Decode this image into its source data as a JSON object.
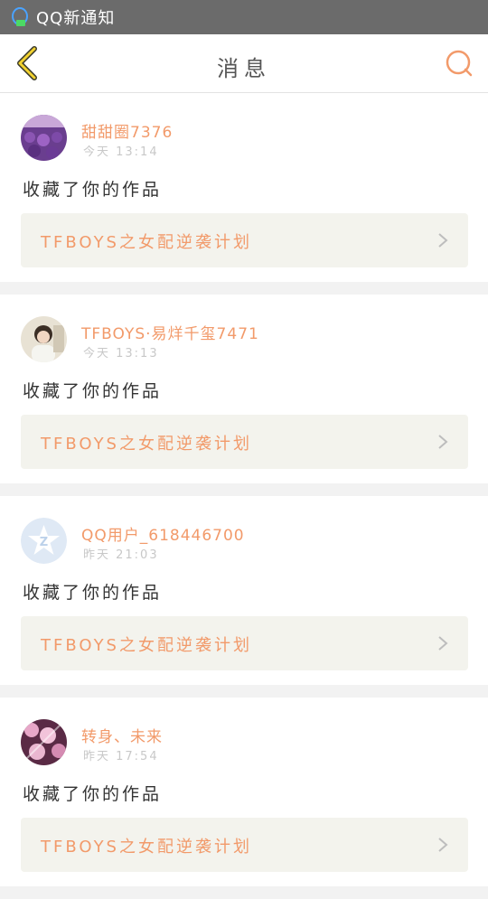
{
  "statusbar": {
    "notification_text": "QQ新通知",
    "icon": "qq-notification-icon"
  },
  "header": {
    "title": "消息",
    "back_icon": "chevron-left-icon",
    "search_icon": "search-icon"
  },
  "colors": {
    "accent_orange": "#f29a6a",
    "link_bg": "#f3f3ed"
  },
  "messages": [
    {
      "user": "甜甜圈7376",
      "time": "今天 13:14",
      "action": "收藏了你的作品",
      "work_title": "TFBOYS之女配逆袭计划",
      "avatar": "lavender-field-avatar"
    },
    {
      "user": "TFBOYS·易烊千玺7471",
      "time": "今天 13:13",
      "action": "收藏了你的作品",
      "work_title": "TFBOYS之女配逆袭计划",
      "avatar": "boy-photo-avatar"
    },
    {
      "user": "QQ用户_618446700",
      "time": "昨天 21:03",
      "action": "收藏了你的作品",
      "work_title": "TFBOYS之女配逆袭计划",
      "avatar": "qq-default-avatar"
    },
    {
      "user": "转身、未来",
      "time": "昨天 17:54",
      "action": "收藏了你的作品",
      "work_title": "TFBOYS之女配逆袭计划",
      "avatar": "pink-flowers-avatar"
    }
  ]
}
